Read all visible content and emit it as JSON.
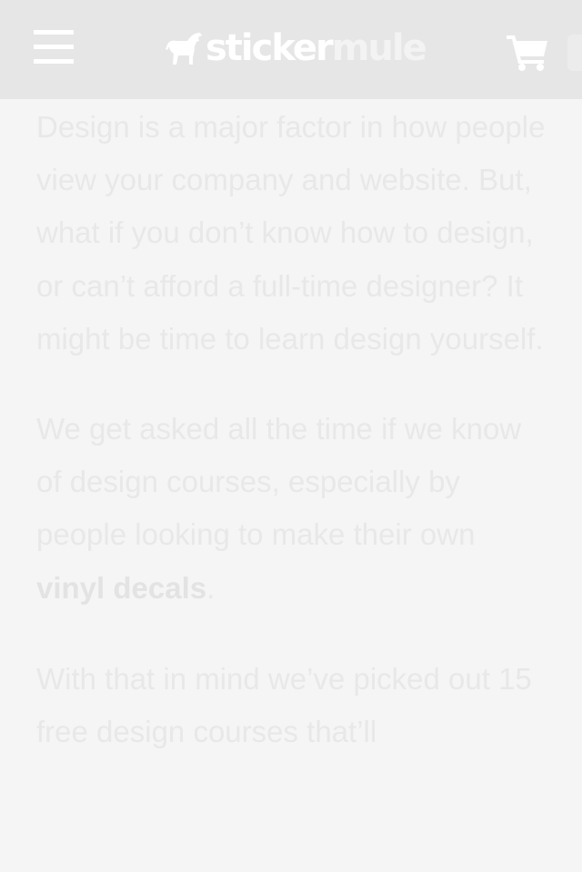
{
  "header": {
    "menu_icon": "hamburger-menu-icon",
    "logo": {
      "mark_icon": "mule-logo-icon",
      "part1": "sticker",
      "part2": "mule"
    },
    "cart_icon": "shopping-cart-icon"
  },
  "article": {
    "paragraph1": "Design is a major factor in how people view your company and website. But, what if you don’t know how to design, or can’t afford a full-time designer? It might be time to learn design yourself.",
    "paragraph2_text": "We get asked all the time if we know of design courses, especially by people looking to make their own ",
    "paragraph2_link": "vinyl decals",
    "paragraph2_end": ".",
    "paragraph3": "With that in mind we’ve picked out 15 free design courses that’ll"
  },
  "colors": {
    "header_bg": "#e6e6e6",
    "page_bg": "#f5f5f5",
    "text": "#e8e8e8",
    "icon": "#ffffff"
  }
}
